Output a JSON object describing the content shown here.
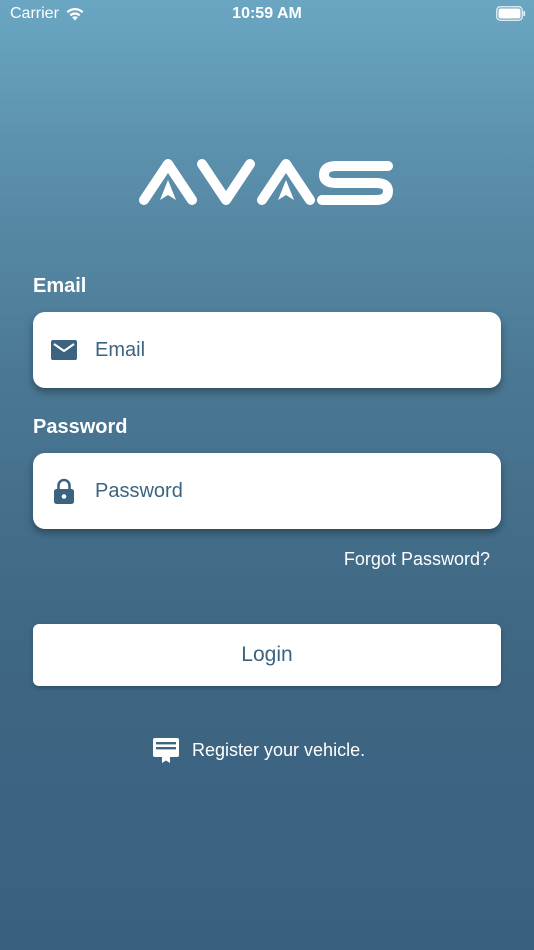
{
  "status_bar": {
    "carrier": "Carrier",
    "time": "10:59 AM"
  },
  "logo": {
    "text": "AVAS"
  },
  "email": {
    "label": "Email",
    "placeholder": "Email",
    "value": ""
  },
  "password": {
    "label": "Password",
    "placeholder": "Password",
    "value": ""
  },
  "forgot_password": "Forgot Password?",
  "login_button": "Login",
  "register_link": "Register your vehicle.",
  "colors": {
    "accent": "#3c6481",
    "background_top": "#6aa6c2",
    "background_bottom": "#3a6080"
  },
  "icons": {
    "email": "envelope-icon",
    "password": "lock-icon",
    "register": "id-card-icon"
  }
}
